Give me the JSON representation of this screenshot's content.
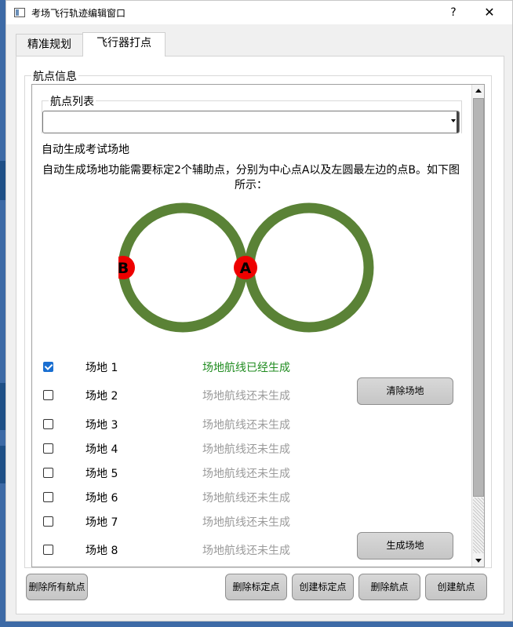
{
  "window": {
    "title": "考场飞行轨迹编辑窗口",
    "help_label": "?",
    "close_label": "✕"
  },
  "tabs": [
    {
      "label": "精准规划",
      "active": false
    },
    {
      "label": "飞行器打点",
      "active": true
    }
  ],
  "waypoint_group": {
    "title": "航点信息",
    "list_group_title": "航点列表",
    "combo_value": ""
  },
  "auto_gen": {
    "title": "自动生成考试场地",
    "description": "自动生成场地功能需要标定2个辅助点，分别为中心点A以及左圆最左边的点B。如下图所示：",
    "figure": {
      "ring_color": "#5a8236",
      "marker_color": "#ee0000",
      "point_a_label": "A",
      "point_b_label": "B"
    }
  },
  "fields": [
    {
      "name": "场地 1",
      "status": "场地航线已经生成",
      "checked": true,
      "generated": true
    },
    {
      "name": "场地 2",
      "status": "场地航线还未生成",
      "checked": false,
      "generated": false
    },
    {
      "name": "场地 3",
      "status": "场地航线还未生成",
      "checked": false,
      "generated": false
    },
    {
      "name": "场地 4",
      "status": "场地航线还未生成",
      "checked": false,
      "generated": false
    },
    {
      "name": "场地 5",
      "status": "场地航线还未生成",
      "checked": false,
      "generated": false
    },
    {
      "name": "场地 6",
      "status": "场地航线还未生成",
      "checked": false,
      "generated": false
    },
    {
      "name": "场地 7",
      "status": "场地航线还未生成",
      "checked": false,
      "generated": false
    },
    {
      "name": "场地 8",
      "status": "场地航线还未生成",
      "checked": false,
      "generated": false
    }
  ],
  "side_buttons": {
    "clear_field": "清除场地",
    "generate_field": "生成场地"
  },
  "bottom_buttons": {
    "delete_all": "删除所有航点",
    "delete_calib": "删除标定点",
    "create_calib": "创建标定点",
    "delete_waypoint": "删除航点",
    "create_waypoint": "创建航点"
  },
  "colors": {
    "status_done": "#1f8b1f",
    "status_pending": "#9a9a9a",
    "checkbox_checked": "#1a6fd1",
    "desktop": "#3d6aa6"
  }
}
